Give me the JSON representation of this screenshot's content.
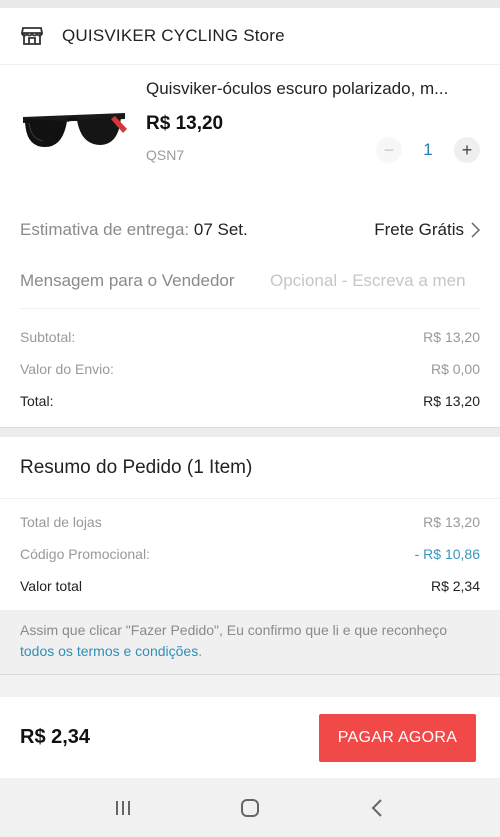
{
  "store": {
    "name": "QUISVIKER CYCLING Store",
    "icon": "store-icon"
  },
  "product": {
    "title": "Quisviker-óculos escuro polarizado, m...",
    "price": "R$ 13,20",
    "sku": "QSN7",
    "quantity": "1",
    "minus": "−",
    "plus": "+"
  },
  "delivery": {
    "label": "Estimativa de entrega: ",
    "date": "07 Set.",
    "shipping": "Frete Grátis"
  },
  "message": {
    "label": "Mensagem para o Vendedor",
    "placeholder": "Opcional - Escreva a men"
  },
  "totals": {
    "subtotal_label": "Subtotal:",
    "subtotal_value": "R$ 13,20",
    "shipping_label": "Valor do Envio:",
    "shipping_value": "R$ 0,00",
    "total_label": "Total:",
    "total_value": "R$ 13,20"
  },
  "summary": {
    "title": "Resumo do Pedido (1 Item)",
    "stores_label": "Total de lojas",
    "stores_value": "R$ 13,20",
    "promo_label": "Código Promocional:",
    "promo_value": "- R$ 10,86",
    "final_label": "Valor total",
    "final_value": "R$ 2,34"
  },
  "terms": {
    "text": "Assim que clicar \"Fazer Pedido\", Eu confirmo que li e que reconheço ",
    "link": "todos os termos e condições",
    "end": "."
  },
  "footer": {
    "total": "R$ 2,34",
    "pay_button": "PAGAR AGORA"
  },
  "colors": {
    "accent": "#f14848",
    "link": "#2f8fb8",
    "quantity": "#2a7bb0"
  }
}
